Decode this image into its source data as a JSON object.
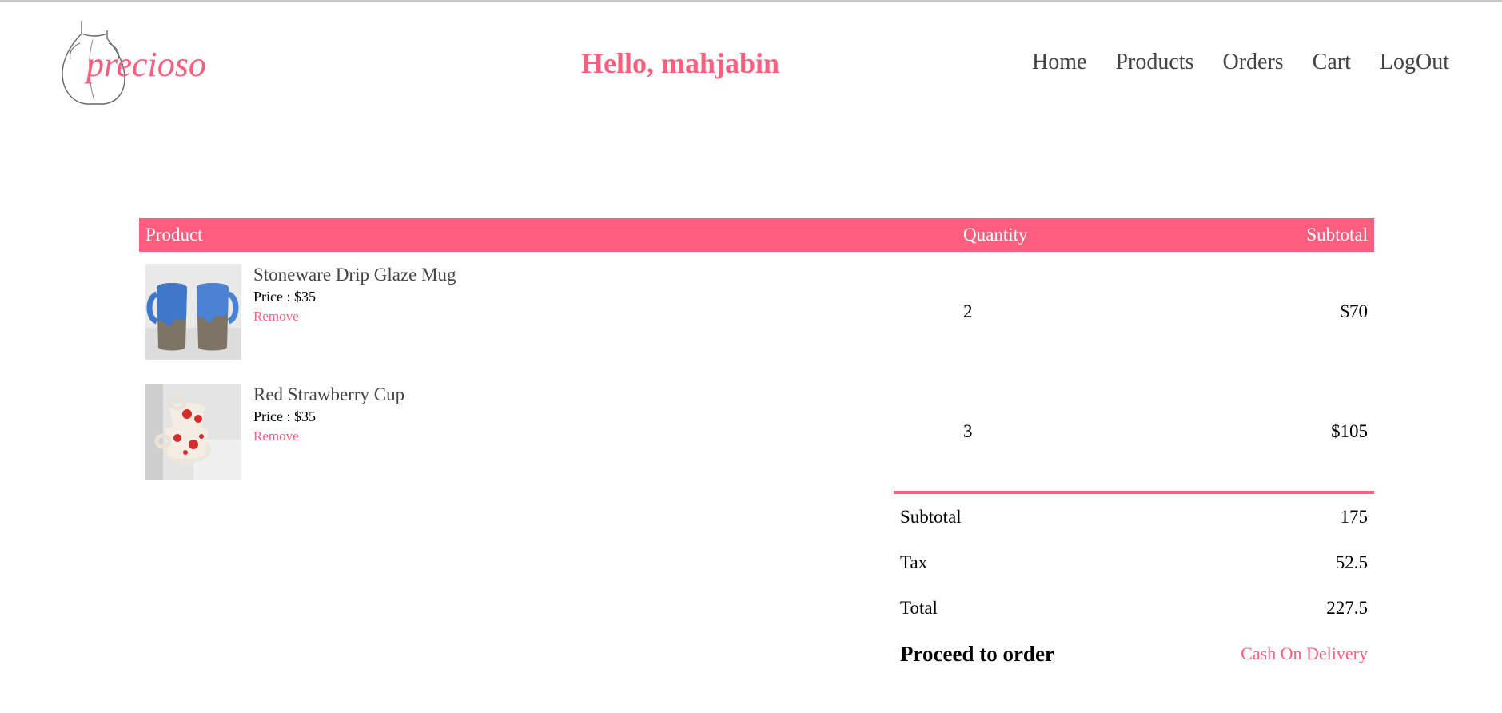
{
  "brand": {
    "logo_text": "precioso",
    "logo_icon": "vase-outline-icon",
    "accent_color": "#ff5e7e"
  },
  "header": {
    "greeting": "Hello, mahjabin"
  },
  "nav": {
    "items": [
      {
        "label": "Home"
      },
      {
        "label": "Products"
      },
      {
        "label": "Orders"
      },
      {
        "label": "Cart"
      },
      {
        "label": "LogOut"
      }
    ]
  },
  "cart": {
    "columns": {
      "product": "Product",
      "quantity": "Quantity",
      "subtotal": "Subtotal"
    },
    "items": [
      {
        "name": "Stoneware Drip Glaze Mug",
        "price": "Price : $35",
        "remove_label": "Remove",
        "quantity": "2",
        "subtotal": "$70",
        "image": "blue-drip-glaze-mugs"
      },
      {
        "name": "Red Strawberry Cup",
        "price": "Price : $35",
        "remove_label": "Remove",
        "quantity": "3",
        "subtotal": "$105",
        "image": "strawberry-cups"
      }
    ]
  },
  "totals": {
    "subtotal_label": "Subtotal",
    "subtotal_value": "175",
    "tax_label": "Tax",
    "tax_value": "52.5",
    "total_label": "Total",
    "total_value": "227.5",
    "proceed_label": "Proceed to order",
    "payment_option": "Cash On Delivery"
  }
}
